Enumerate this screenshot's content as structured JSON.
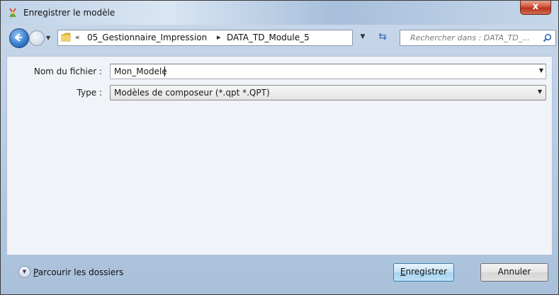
{
  "window": {
    "title": "Enregistrer le modèle",
    "close_label": "x"
  },
  "navbar": {
    "breadcrumb_prefix": "«",
    "crumbs": [
      "05_Gestionnaire_Impression",
      "DATA_TD_Module_5"
    ],
    "separator": "▸",
    "search_placeholder": "Rechercher dans : DATA_TD_..."
  },
  "form": {
    "filename_label": "Nom du fichier :",
    "filename_value": "Mon_Modele",
    "type_label": "Type :",
    "type_value": "Modèles de composeur (*.qpt *.QPT)"
  },
  "footer": {
    "browse_label": "Parcourir les dossiers",
    "save_label": "Enregistrer",
    "cancel_label": "Annuler"
  },
  "colors": {
    "accent": "#3a7fd0",
    "close": "#c8452e",
    "folder": "#e8b93a"
  }
}
